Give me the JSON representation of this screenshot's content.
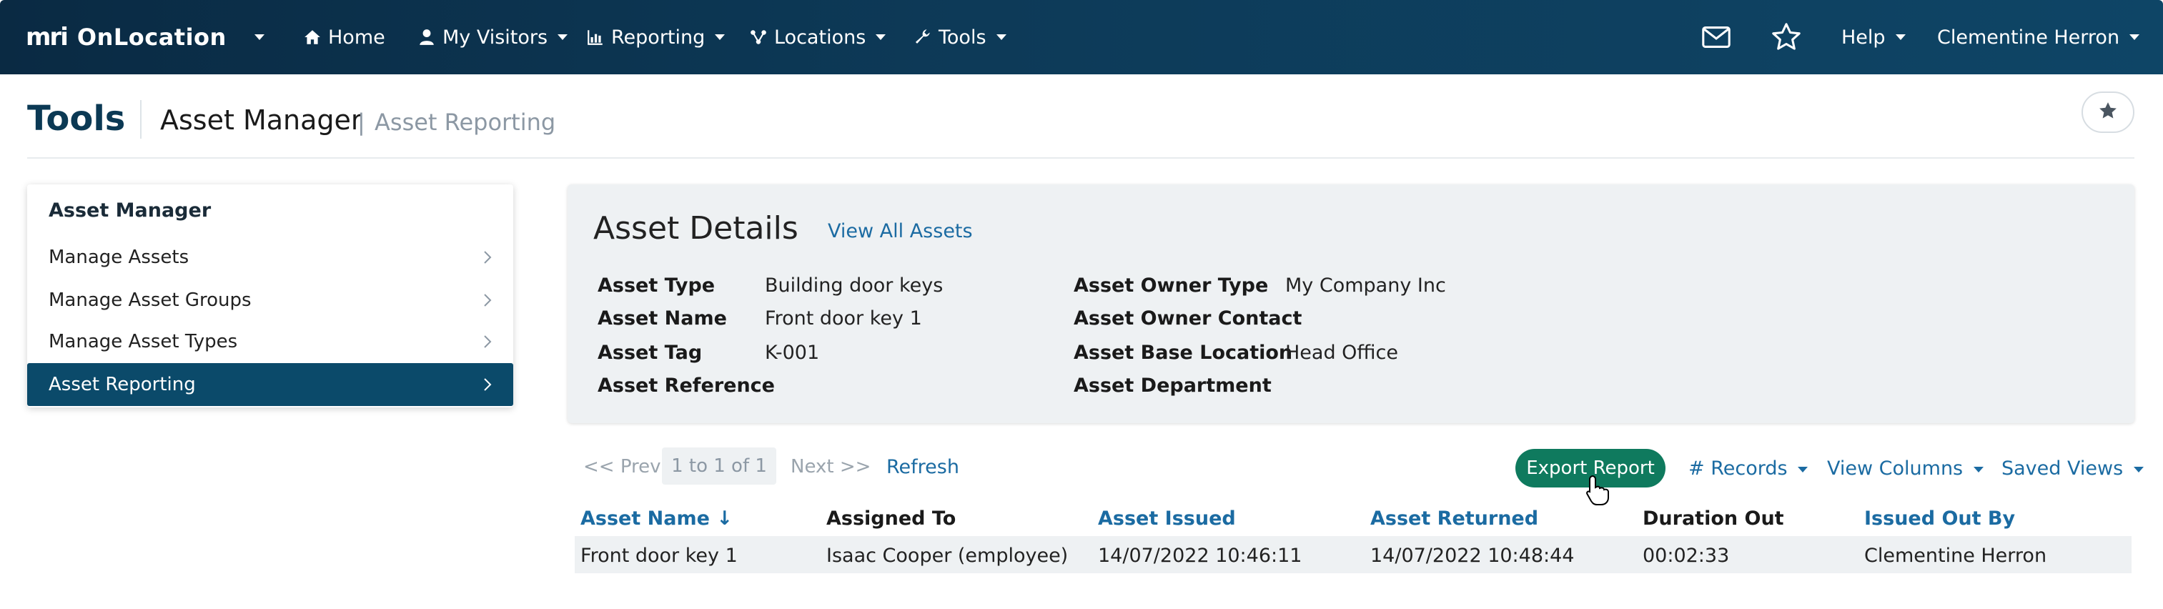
{
  "nav": {
    "logo_mark": "mri",
    "app_name": "OnLocation",
    "items": [
      {
        "label": "Home",
        "icon": "home-icon"
      },
      {
        "label": "My Visitors",
        "icon": "user-icon"
      },
      {
        "label": "Reporting",
        "icon": "bar-chart-icon"
      },
      {
        "label": "Locations",
        "icon": "network-icon"
      },
      {
        "label": "Tools",
        "icon": "wrench-icon"
      }
    ],
    "help_label": "Help",
    "user_name": "Clementine Herron"
  },
  "page": {
    "title": "Tools",
    "breadcrumb_main": "Asset Manager",
    "breadcrumb_separator": "|",
    "breadcrumb_sub": "Asset Reporting"
  },
  "sidebar": {
    "heading": "Asset Manager",
    "items": [
      {
        "label": "Manage Assets",
        "active": false
      },
      {
        "label": "Manage Asset Groups",
        "active": false
      },
      {
        "label": "Manage Asset Types",
        "active": false
      },
      {
        "label": "Asset Reporting",
        "active": true
      }
    ]
  },
  "details": {
    "title": "Asset Details",
    "view_all_label": "View All Assets",
    "left": [
      {
        "label": "Asset Type",
        "value": "Building door keys"
      },
      {
        "label": "Asset Name",
        "value": "Front door key 1"
      },
      {
        "label": "Asset Tag",
        "value": "K-001"
      },
      {
        "label": "Asset Reference",
        "value": ""
      }
    ],
    "right": [
      {
        "label": "Asset Owner Type",
        "value": "My Company Inc"
      },
      {
        "label": "Asset Owner Contact",
        "value": ""
      },
      {
        "label": "Asset Base Location",
        "value": "Head Office"
      },
      {
        "label": "Asset Department",
        "value": ""
      }
    ]
  },
  "toolbar": {
    "prev_label": "<< Prev",
    "range_label": "1 to 1 of 1",
    "next_label": "Next >>",
    "refresh_label": "Refresh",
    "export_label": "Export Report",
    "records_label": "# Records",
    "view_columns_label": "View Columns",
    "saved_views_label": "Saved Views"
  },
  "table": {
    "columns": [
      {
        "label": "Asset Name ↓",
        "sortable": true
      },
      {
        "label": "Assigned To",
        "sortable": false
      },
      {
        "label": "Asset Issued",
        "sortable": true
      },
      {
        "label": "Asset Returned",
        "sortable": true
      },
      {
        "label": "Duration Out",
        "sortable": false
      },
      {
        "label": "Issued Out By",
        "sortable": true
      }
    ],
    "rows": [
      [
        "Front door key 1",
        "Isaac Cooper (employee)",
        "14/07/2022 10:46:11",
        "14/07/2022 10:48:44",
        "00:02:33",
        "Clementine Herron"
      ]
    ]
  },
  "colors": {
    "nav_bg": "#0d3a58",
    "accent_link": "#1b6ba2",
    "active_item": "#0b4a6a",
    "export_button": "#0f7a5e"
  }
}
